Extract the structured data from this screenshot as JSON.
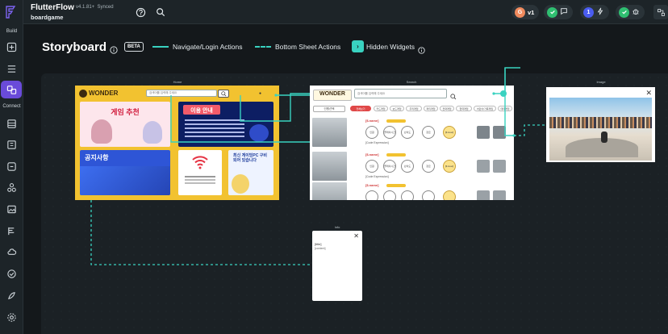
{
  "app": {
    "title": "FlutterFlow",
    "version": "v4.1.81+",
    "sync_status": "Synced",
    "project": "boardgame"
  },
  "topbar": {
    "version_badge": "v1",
    "user_badge": "1"
  },
  "sidebar": {
    "section_build": "Build",
    "section_connect": "Connect",
    "items": [
      "pages-icon",
      "widget-tree-icon",
      "storyboard-icon",
      "firestore-icon",
      "api-calls-icon",
      "app-state-icon",
      "custom-code-icon",
      "media-assets-icon",
      "app-settings-icon",
      "cloud-functions-icon",
      "testing-icon",
      "theme-icon",
      "settings-icon"
    ]
  },
  "storyboard": {
    "title": "Storyboard",
    "beta_label": "BETA",
    "legend": {
      "navigate": "Navigate/Login Actions",
      "bottom_sheet": "Bottom Sheet Actions",
      "hidden": "Hidden Widgets"
    }
  },
  "screens": {
    "home": {
      "label": "Home",
      "logo": "WONDER",
      "search_placeholder": "검색어를 입력해 주세요",
      "tiles": {
        "recommend": "게임 추천",
        "guide": "이용 안내",
        "notice": "공지사항",
        "pc": "최신 게이밍PC 구비되어 있습니다"
      }
    },
    "search": {
      "label": "Search",
      "logo": "WONDER",
      "search_placeholder": "검색어를 입력해 주세요",
      "sort": "인원선택",
      "chips": [
        "전체보기",
        "카드게임",
        "보드게임",
        "추리게임",
        "파티게임",
        "전략게임",
        "협력게임",
        "어린이/가족게임",
        "테마게임"
      ],
      "row_name": "[$.name]",
      "row_expression": "[Code Expression]",
      "bubble_labels": [
        "인원",
        "플레이시간",
        "난이도",
        "장르",
        "[$.level]"
      ]
    },
    "image": {
      "label": "Image"
    },
    "info": {
      "label": "Info",
      "title": "[title]",
      "content": "[content]"
    }
  },
  "colors": {
    "accent": "#39d2c0",
    "sidebar_active": "#6a4bd9",
    "home_bg": "#f2c230",
    "canvas": "#1b2125"
  }
}
